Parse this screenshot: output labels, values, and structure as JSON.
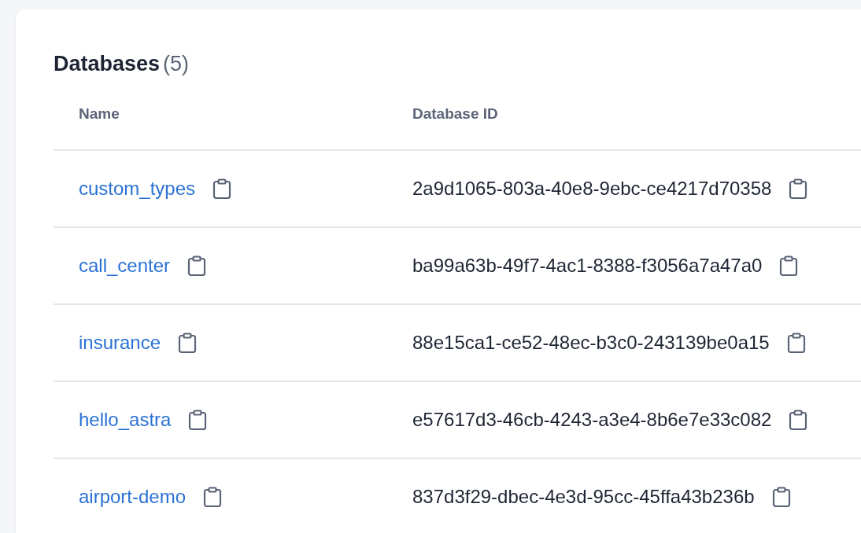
{
  "section": {
    "title": "Databases",
    "count": "(5)"
  },
  "table": {
    "columns": [
      "Name",
      "Database ID"
    ],
    "rows": [
      {
        "name": "custom_types",
        "id": "2a9d1065-803a-40e8-9ebc-ce4217d70358"
      },
      {
        "name": "call_center",
        "id": "ba99a63b-49f7-4ac1-8388-f3056a7a47a0"
      },
      {
        "name": "insurance",
        "id": "88e15ca1-ce52-48ec-b3c0-243139be0a15"
      },
      {
        "name": "hello_astra",
        "id": "e57617d3-46cb-4243-a3e4-8b6e7e33c082"
      },
      {
        "name": "airport-demo",
        "id": "837d3f29-dbec-4e3d-95cc-45ffa43b236b"
      }
    ]
  }
}
